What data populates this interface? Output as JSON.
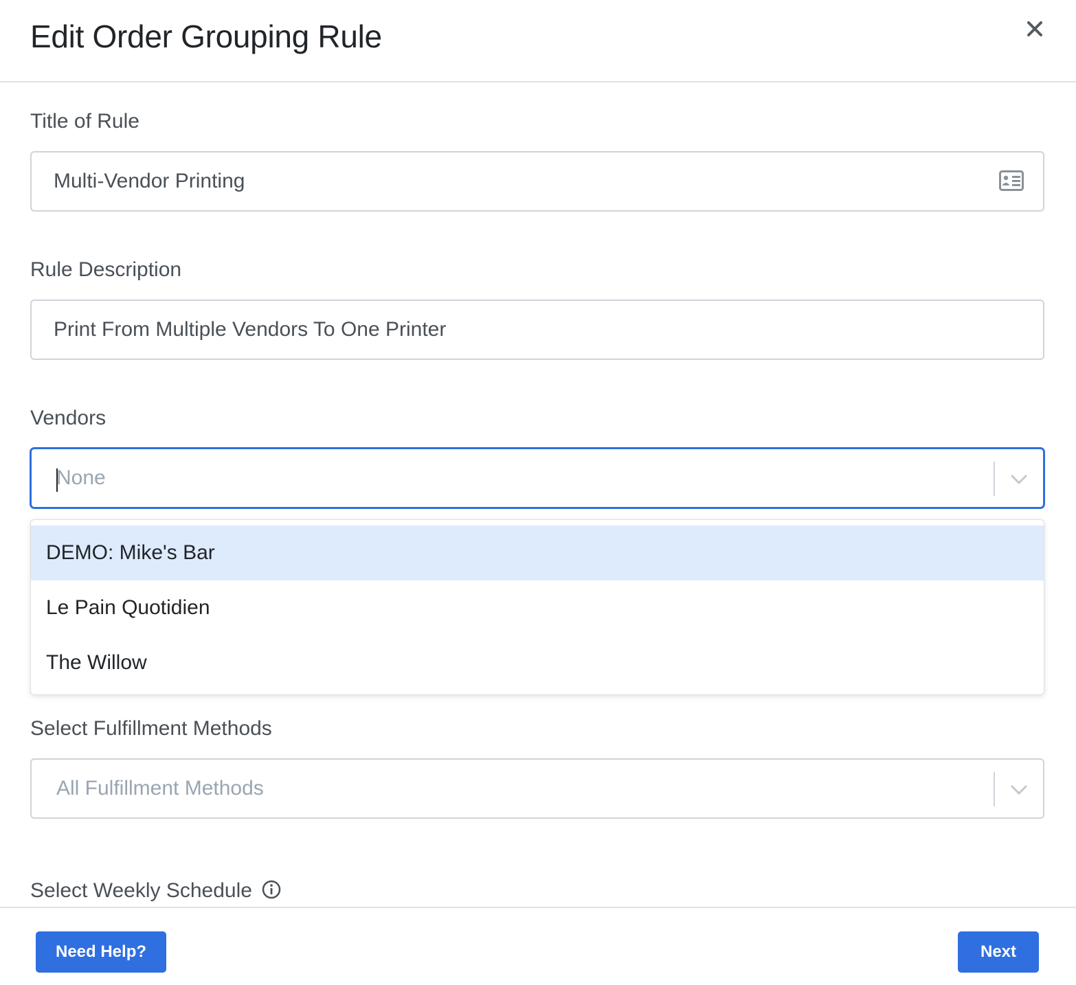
{
  "modal": {
    "title": "Edit Order Grouping Rule"
  },
  "form": {
    "title_field": {
      "label": "Title of Rule",
      "value": "Multi-Vendor Printing"
    },
    "description_field": {
      "label": "Rule Description",
      "value": "Print From Multiple Vendors To One Printer"
    },
    "vendors": {
      "label": "Vendors",
      "placeholder": "None",
      "options": [
        "DEMO: Mike's Bar",
        "Le Pain Quotidien",
        "The Willow"
      ],
      "highlighted_index": 0
    },
    "fulfillment": {
      "label": "Select Fulfillment Methods",
      "placeholder": "All Fulfillment Methods"
    },
    "schedule": {
      "label": "Select Weekly Schedule"
    }
  },
  "footer": {
    "help_label": "Need Help?",
    "next_label": "Next"
  },
  "colors": {
    "primary": "#2f6fe0",
    "highlight": "#deebfd"
  },
  "icons": {
    "close": "close-icon",
    "contact_card": "contact-card-icon",
    "chevron": "chevron-down-icon",
    "info": "info-icon"
  }
}
